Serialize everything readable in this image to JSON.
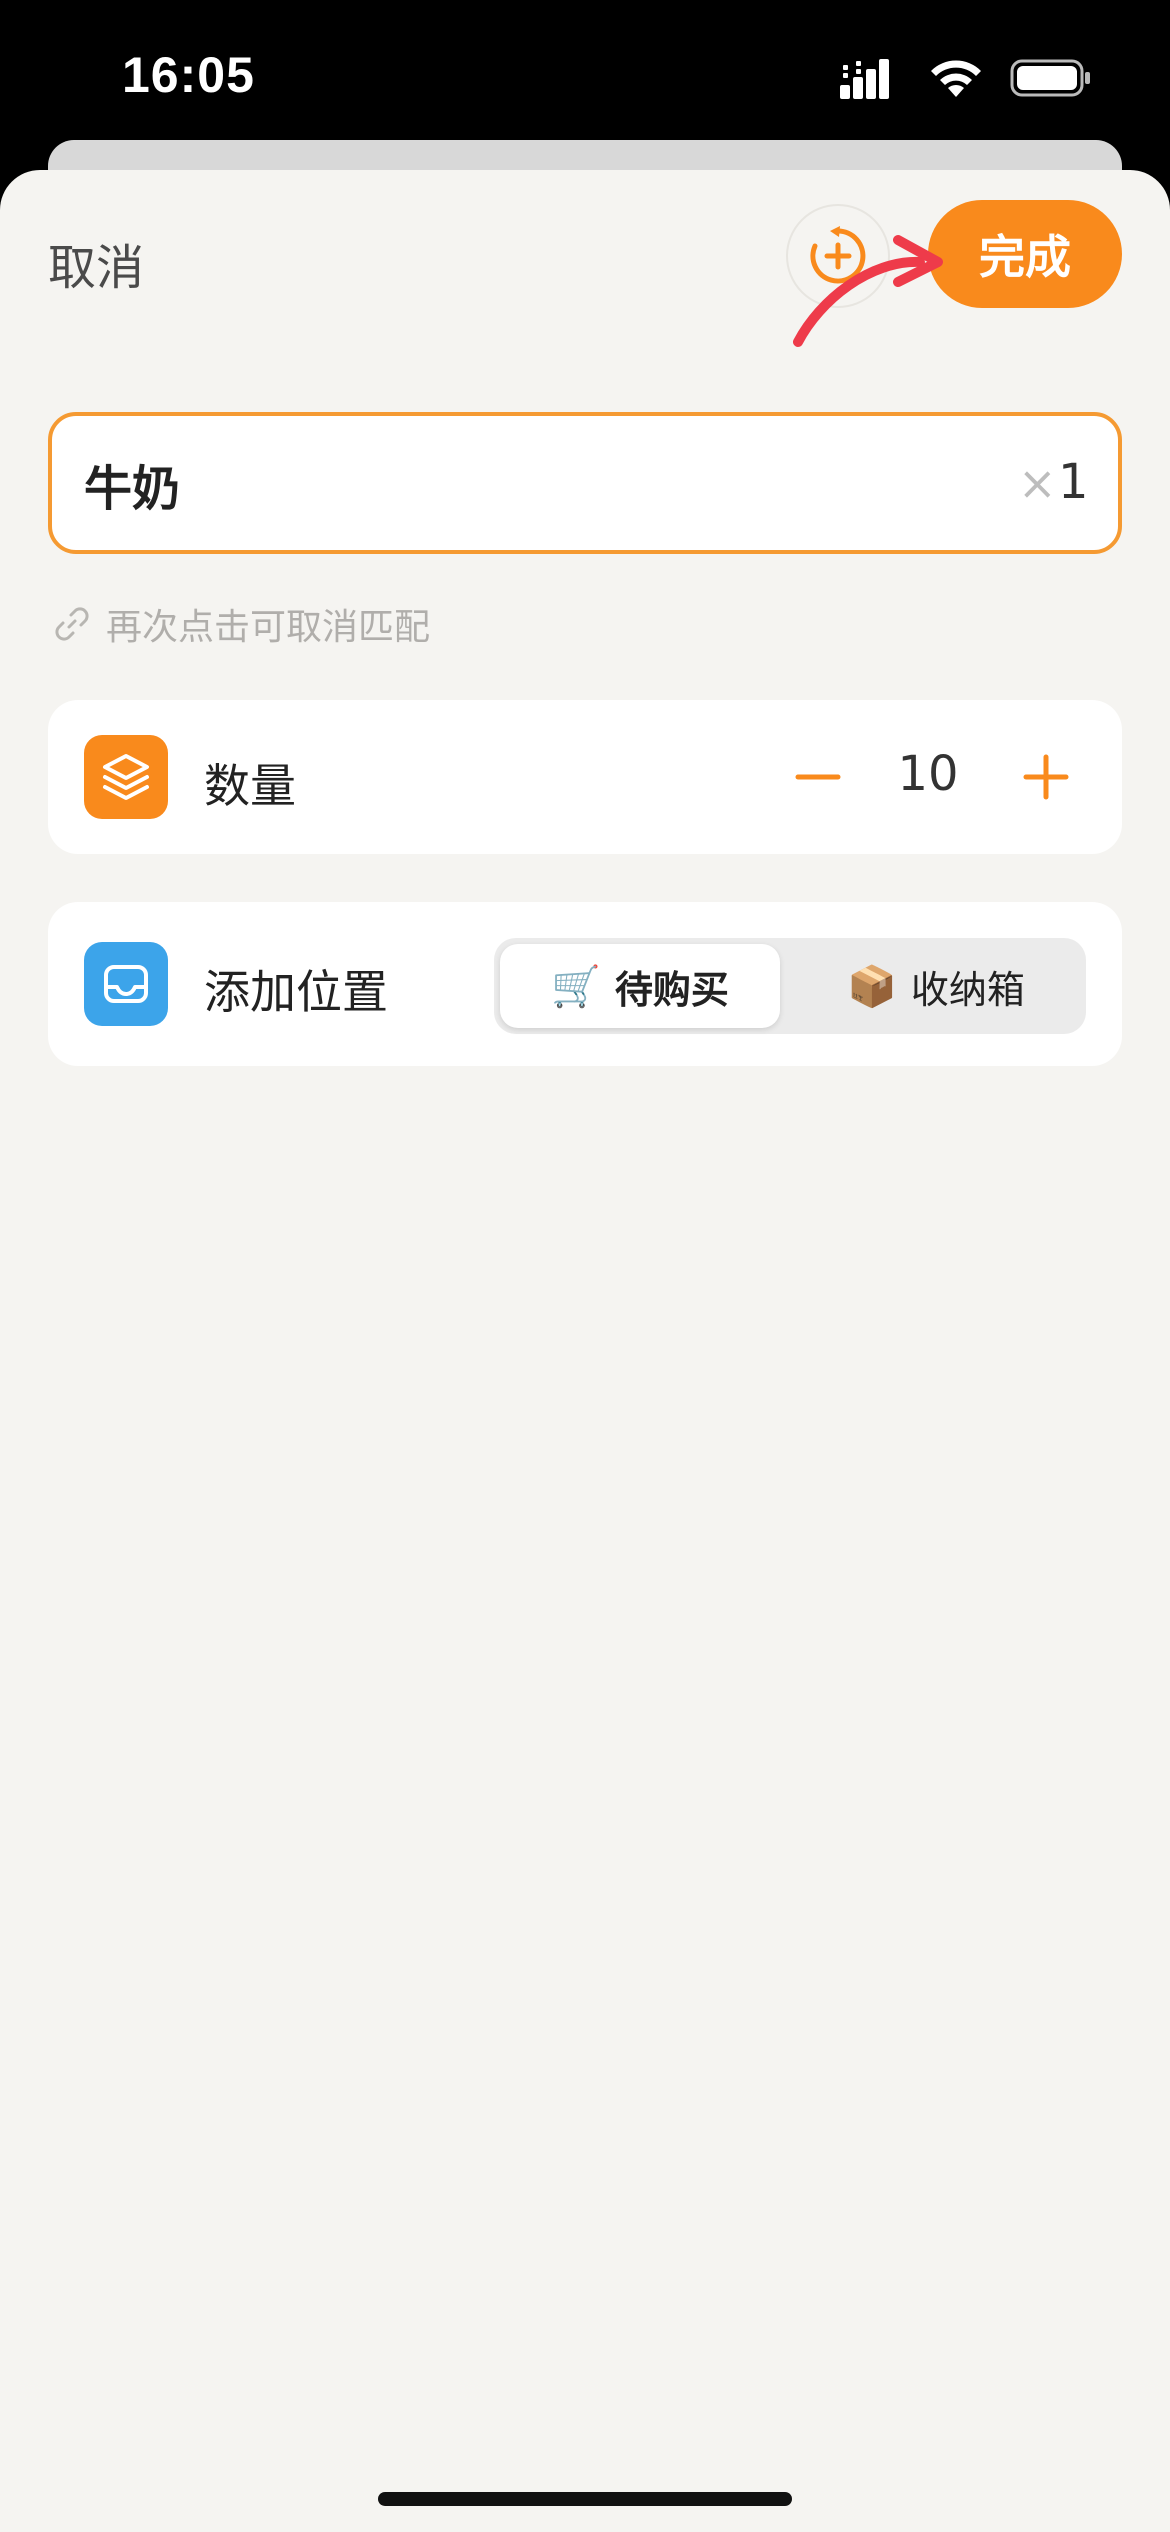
{
  "status_bar": {
    "time": "16:05"
  },
  "header": {
    "cancel_label": "取消",
    "done_label": "完成",
    "timer_icon": "timer-plus-icon"
  },
  "item": {
    "name": "牛奶",
    "multiplier_symbol": "×",
    "multiplier_value": "1"
  },
  "hint": {
    "text": "再次点击可取消匹配",
    "icon": "link-icon"
  },
  "quantity": {
    "label": "数量",
    "value": "10",
    "icon": "layers-icon"
  },
  "location": {
    "label": "添加位置",
    "icon": "tray-icon",
    "options": [
      {
        "emoji": "🛒",
        "label": "待购买",
        "selected": true
      },
      {
        "emoji": "📦",
        "label": "收纳箱",
        "selected": false
      }
    ]
  },
  "colors": {
    "accent": "#f98a1c",
    "blue": "#3ca4ea",
    "annotation": "#ee3b4a"
  }
}
